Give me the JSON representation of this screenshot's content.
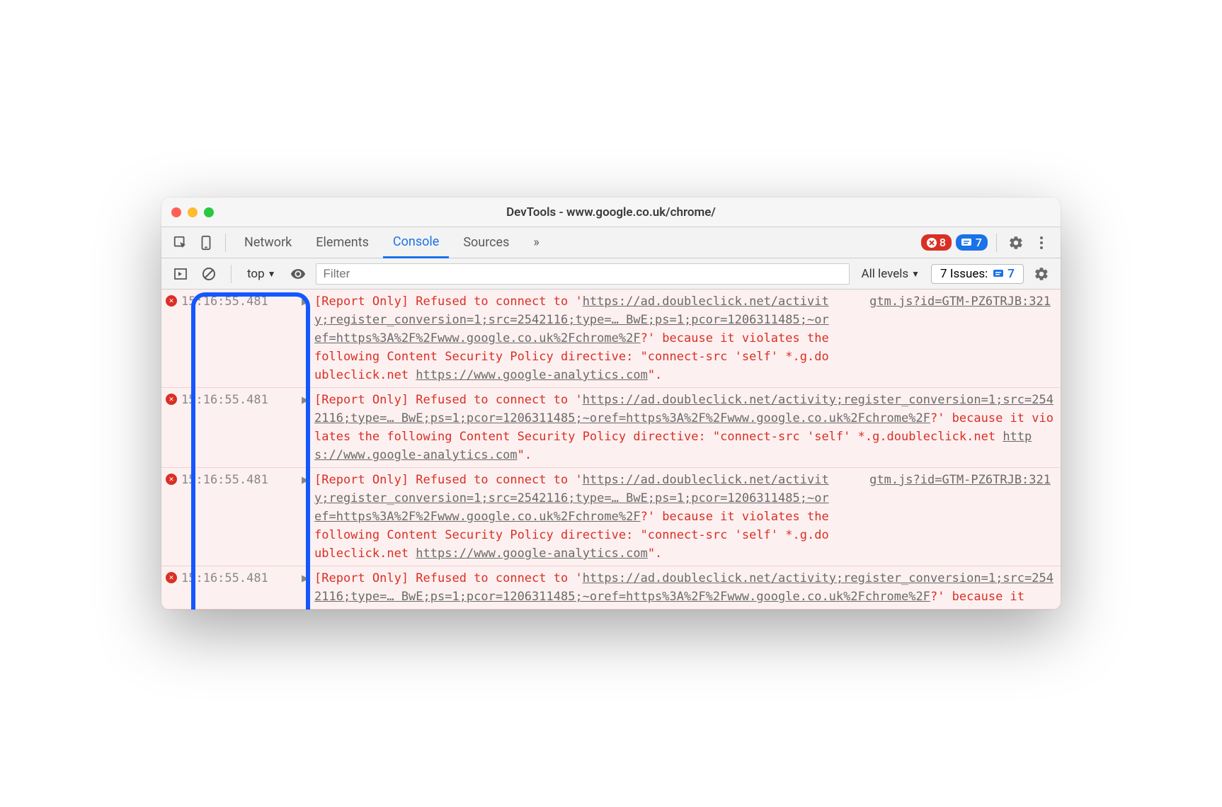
{
  "window": {
    "title": "DevTools - www.google.co.uk/chrome/"
  },
  "tabbar": {
    "tabs": [
      "Network",
      "Elements",
      "Console",
      "Sources"
    ],
    "active": "Console",
    "more": "»",
    "errorCount": "8",
    "warnCount": "7"
  },
  "toolbar": {
    "context": "top",
    "filterPlaceholder": "Filter",
    "levels": "All levels",
    "issuesLabel": "7 Issues:",
    "issuesCount": "7"
  },
  "logs": [
    {
      "ts": "15:16:55.481",
      "source": "gtm.js?id=GTM-PZ6TRJB:321",
      "pre1": "[Report Only] Refused to connect to '",
      "url1": "https://ad.doubleclick.net/activity;register_conversion=1;src=2542116;type=… BwE;ps=1;pcor=1206311485;~oref=https%3A%2F%2Fwww.google.co.uk%2Fchrome%2F",
      "mid1": "?' because it violates the following Content Security Policy directive: \"connect-src 'self' *.g.doubleclick.net ",
      "url2": "https://www.google-analytics.com",
      "post1": "\"."
    },
    {
      "ts": "15:16:55.481",
      "source": "",
      "pre1": "[Report Only] Refused to connect to '",
      "url1": "https://ad.doubleclick.net/activity;register_conversion=1;src=2542116;type=… BwE;ps=1;pcor=1206311485;~oref=https%3A%2F%2Fwww.google.co.uk%2Fchrome%2F",
      "mid1": "?' because it violates the following Content Security Policy directive: \"connect-src 'self' *.g.doubleclick.net ",
      "url2": "https://www.google-analytics.com",
      "post1": "\"."
    },
    {
      "ts": "15:16:55.481",
      "source": "gtm.js?id=GTM-PZ6TRJB:321",
      "pre1": "[Report Only] Refused to connect to '",
      "url1": "https://ad.doubleclick.net/activity;register_conversion=1;src=2542116;type=… BwE;ps=1;pcor=1206311485;~oref=https%3A%2F%2Fwww.google.co.uk%2Fchrome%2F",
      "mid1": "?' because it violates the following Content Security Policy directive: \"connect-src 'self' *.g.doubleclick.net ",
      "url2": "https://www.google-analytics.com",
      "post1": "\"."
    },
    {
      "ts": "15:16:55.481",
      "source": "",
      "pre1": "[Report Only] Refused to connect to '",
      "url1": "https://ad.doubleclick.net/activity;register_conversion=1;src=2542116;type=… BwE;ps=1;pcor=1206311485;~oref=https%3A%2F%2Fwww.google.co.uk%2Fchrome%2F",
      "mid1": "?' because it ",
      "url2": "",
      "post1": ""
    }
  ]
}
